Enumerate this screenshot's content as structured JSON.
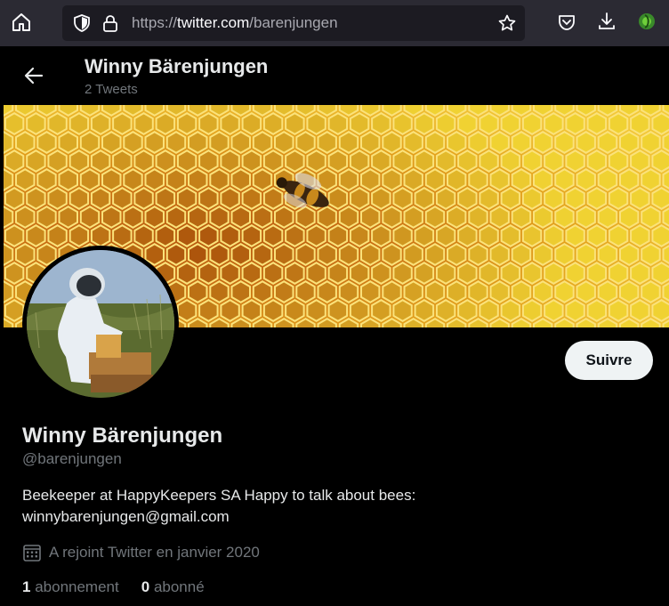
{
  "browser": {
    "url_prefix": "https://",
    "url_host": "twitter.com",
    "url_path": "/barenjungen"
  },
  "header": {
    "name": "Winny Bärenjungen",
    "tweet_count": "2 Tweets"
  },
  "profile": {
    "follow_label": "Suivre",
    "name": "Winny Bärenjungen",
    "handle": "@barenjungen",
    "bio_line1": "Beekeeper at HappyKeepers SA Happy to talk about bees:",
    "bio_line2": "winnybarenjungen@gmail.com",
    "joined": "A rejoint Twitter en janvier 2020",
    "following_count": "1",
    "following_label": "abonnement",
    "followers_count": "0",
    "followers_label": "abonné"
  },
  "colors": {
    "accent_text": "#e7e9ea",
    "secondary_text": "#71767b",
    "button_bg": "#eff3f4"
  }
}
